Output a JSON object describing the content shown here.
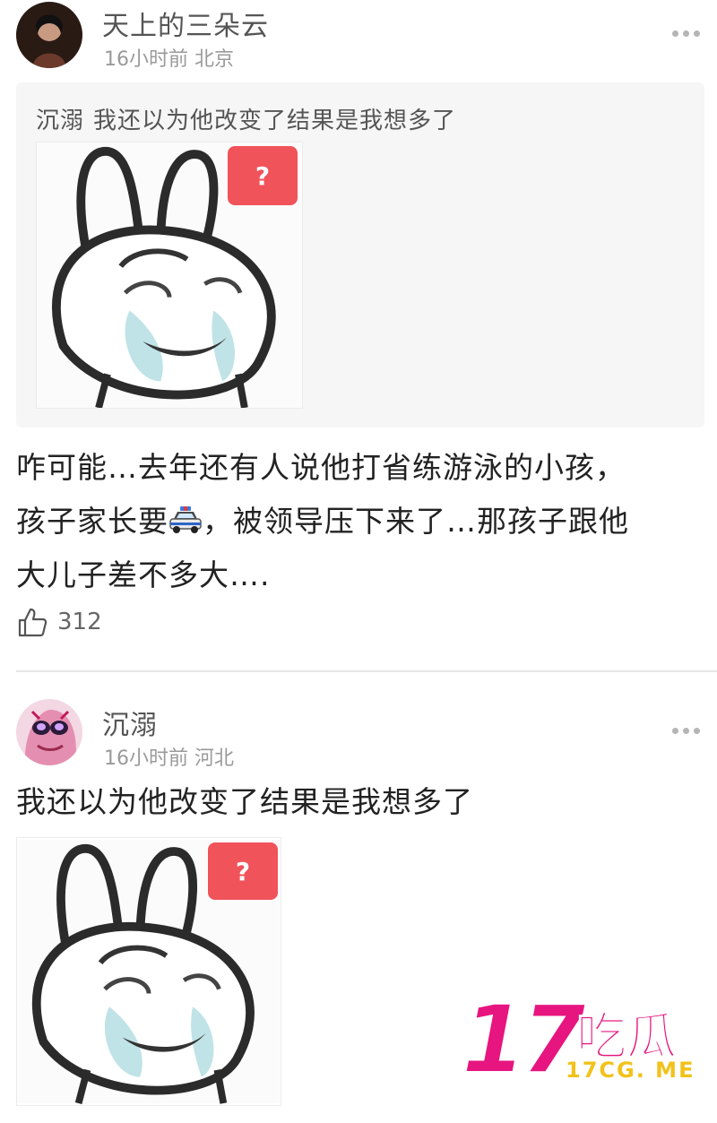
{
  "post": {
    "author": "天上的三朵云",
    "time": "16小时前",
    "location": "北京",
    "quote": {
      "author": "沉溺",
      "text": "我还以为他改变了结果是我想多了",
      "badge": "?"
    },
    "body_lines": [
      "咋可能…去年还有人说他打省练游泳的小孩，",
      "孩子家长要",
      "，被领导压下来了…那孩子跟他",
      "大儿子差不多大…."
    ],
    "likes": "312"
  },
  "reply": {
    "author": "沉溺",
    "time": "16小时前",
    "location": "河北",
    "text": "我还以为他改变了结果是我想多了",
    "badge": "?"
  },
  "watermark": {
    "number": "17",
    "name": "吃瓜",
    "url": "17CG. ME"
  },
  "icons": {
    "more": "more-dots-icon",
    "like": "thumbs-up-icon",
    "emoji": "police-car-icon"
  },
  "colors": {
    "badge": "#f0535a",
    "watermark_pink": "#e7157f",
    "watermark_yellow": "#f2c21a"
  }
}
